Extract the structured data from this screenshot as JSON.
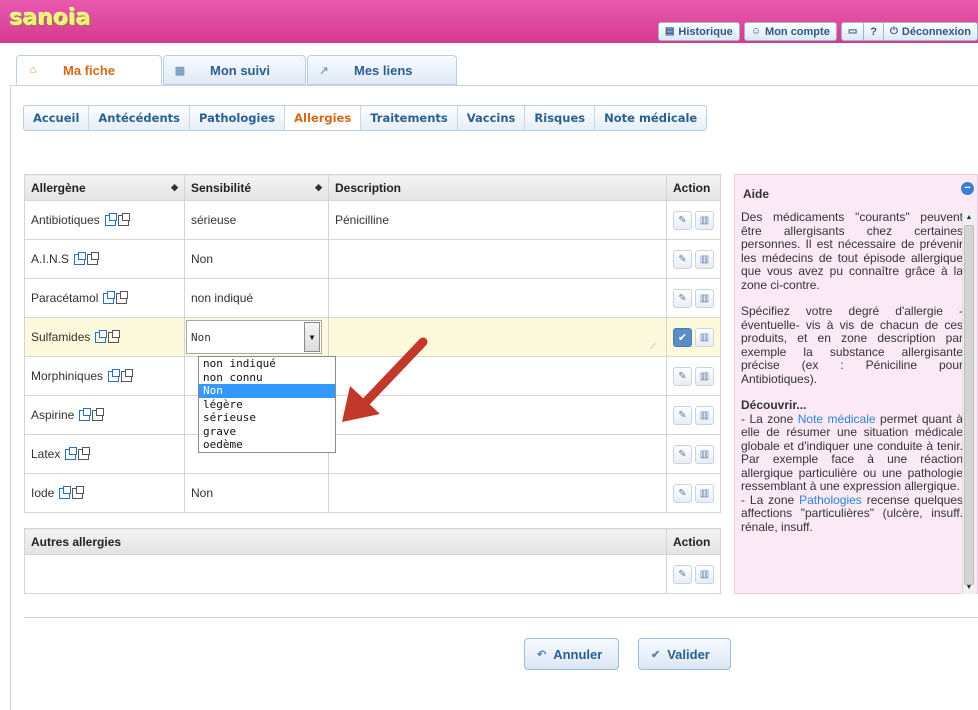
{
  "app": {
    "logo": "sanoia"
  },
  "topbar": {
    "historique": "Historique",
    "mon_compte": "Mon compte",
    "help": "?",
    "deconnexion": "Déconnexion"
  },
  "main_tabs": [
    {
      "label": "Ma fiche",
      "active": true
    },
    {
      "label": "Mon suivi",
      "active": false
    },
    {
      "label": "Mes liens",
      "active": false
    }
  ],
  "sub_tabs": [
    {
      "label": "Accueil"
    },
    {
      "label": "Antécédents"
    },
    {
      "label": "Pathologies"
    },
    {
      "label": "Allergies",
      "active": true
    },
    {
      "label": "Traitements"
    },
    {
      "label": "Vaccins"
    },
    {
      "label": "Risques"
    },
    {
      "label": "Note médicale"
    }
  ],
  "table": {
    "headers": {
      "allergene": "Allergène",
      "sensibilite": "Sensibilité",
      "description": "Description",
      "action": "Action"
    },
    "rows": [
      {
        "allergene": "Antibiotiques",
        "sensibilite": "sérieuse",
        "description": "Pénicilline"
      },
      {
        "allergene": "A.I.N.S",
        "sensibilite": "Non",
        "description": ""
      },
      {
        "allergene": "Paracétamol",
        "sensibilite": "non indiqué",
        "description": ""
      },
      {
        "allergene": "Sulfamides",
        "sensibilite": "Non",
        "description": "",
        "editing": true
      },
      {
        "allergene": "Morphiniques",
        "sensibilite": "",
        "description": ""
      },
      {
        "allergene": "Aspirine",
        "sensibilite": "",
        "description": ""
      },
      {
        "allergene": "Latex",
        "sensibilite": "",
        "description": ""
      },
      {
        "allergene": "Iode",
        "sensibilite": "Non",
        "description": ""
      }
    ]
  },
  "dropdown": {
    "options": [
      "non indiqué",
      "non connu",
      "Non",
      "légère",
      "sérieuse",
      "grave",
      "oedème"
    ],
    "selected": "Non"
  },
  "autres": {
    "header": "Autres allergies",
    "action": "Action"
  },
  "buttons": {
    "annuler": "Annuler",
    "valider": "Valider"
  },
  "aide": {
    "title": "Aide",
    "p1": "Des médicaments \"courants\" peuvent être allergisants chez certaines personnes. Il est nécessaire de prévenir les médecins de tout épisode allergique que vous avez pu connaître grâce à la zone ci-contre.",
    "p2": "Spécifiez votre degré d'allergie - éventuelle- vis à vis de chacun de ces produits, et en zone description par exemple la substance allergisante précise (ex : Péniciline pour Antibiotiques).",
    "decouvrir": "Découvrir...",
    "d1_a": "- La zone ",
    "d1_link": "Note médicale",
    "d1_b": " permet quant à elle de résumer une situation médicale globale et d'indiquer une conduite à tenir. Par exemple face à une réaction allergique particulière ou une pathologie ressemblant à une expression allergique.",
    "d2_a": "- La zone ",
    "d2_link": "Pathologies",
    "d2_b": " recense quelques affections \"particulières\" (ulcère, insuff. rénale, insuff."
  },
  "colors": {
    "topbar": "#d63a8f",
    "active_tab": "#d4691a",
    "tab_text": "#2b5f92",
    "help_bg": "#fbeaf6",
    "select_highlight": "#3399ff",
    "annotation_arrow": "#c0392b"
  }
}
